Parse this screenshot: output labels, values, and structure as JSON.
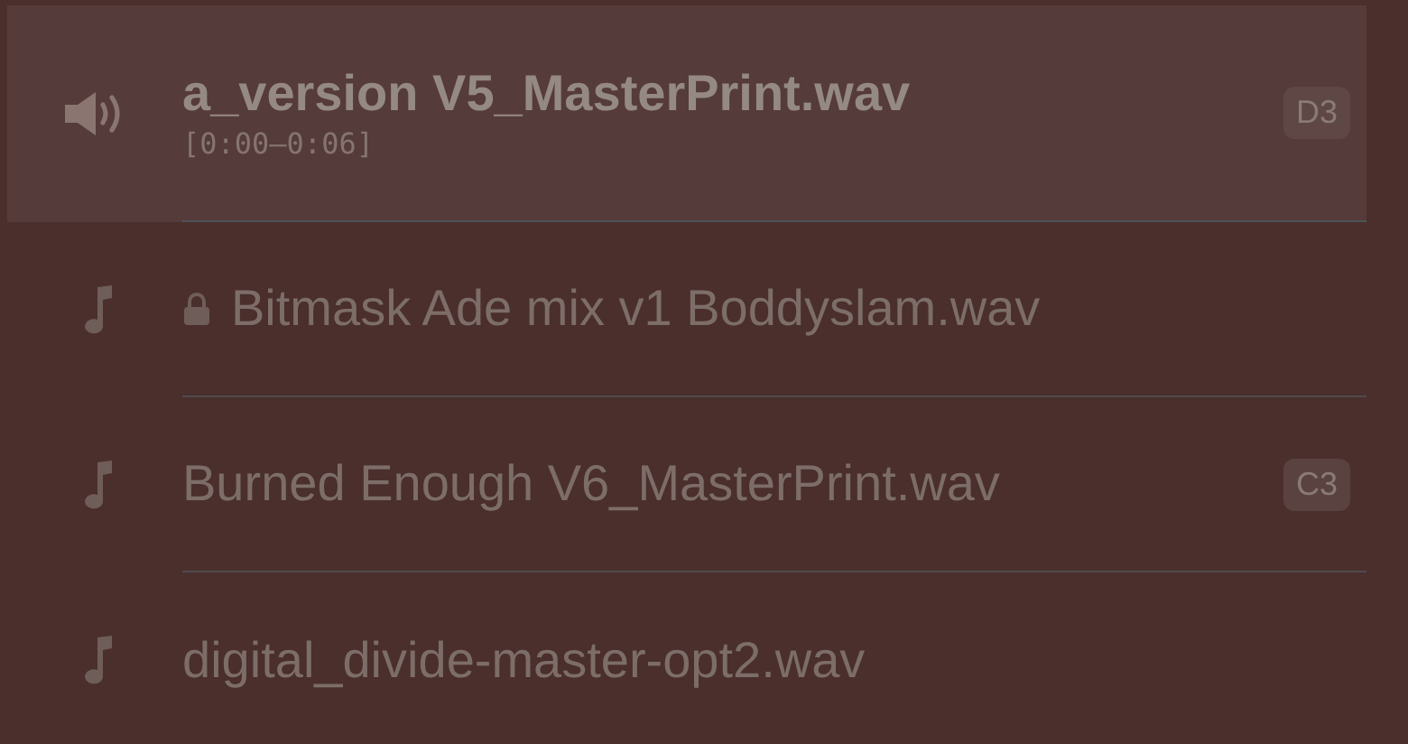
{
  "tracks": [
    {
      "title": "a_version V5_MasterPrint.wav",
      "time": "[0:00–0:06]",
      "key": "D3",
      "selected": true,
      "locked": false
    },
    {
      "title": "Bitmask Ade mix v1 Boddyslam.wav",
      "selected": false,
      "locked": true
    },
    {
      "title": "Burned Enough V6_MasterPrint.wav",
      "key": "C3",
      "selected": false,
      "locked": false
    },
    {
      "title": "digital_divide-master-opt2.wav",
      "selected": false,
      "locked": false
    }
  ]
}
